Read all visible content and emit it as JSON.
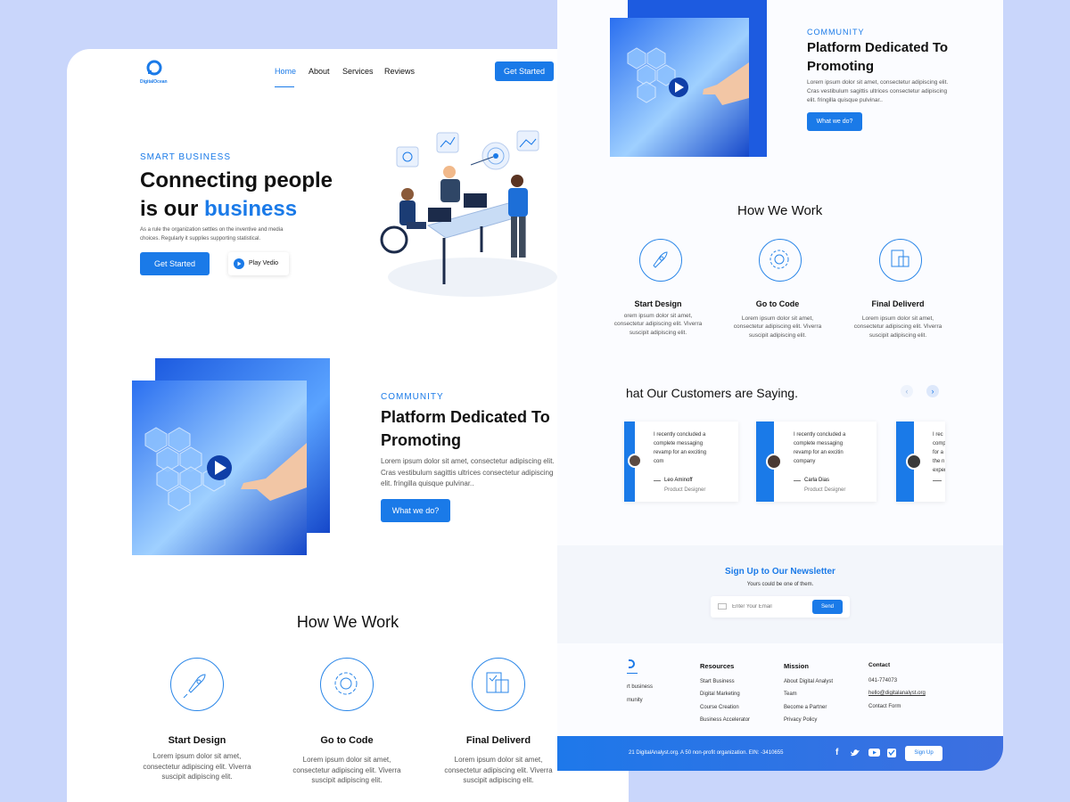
{
  "nav": {
    "logo_text": "DigitalOcean",
    "items": [
      "Home",
      "About",
      "Services",
      "Reviews"
    ],
    "cta": "Get Started"
  },
  "hero": {
    "eyebrow": "SMART BUSINESS",
    "title_line1": "Connecting people",
    "title_line2_prefix": "is our ",
    "title_line2_accent": "business",
    "desc_line1": "As a rule the organization settles on the inventive and media",
    "desc_line2": "choices. Regularly it supplies supporting statistical.",
    "primary_btn": "Get Started",
    "secondary_btn": "Play Vedio"
  },
  "community": {
    "eyebrow": "COMMUNITY",
    "title_line1": "Platform Dedicated To",
    "title_line2": "Promoting",
    "desc_line1": "Lorem ipsum dolor sit amet, consectetur adipiscing elit.",
    "desc_line2": "Cras vestibulum sagittis ultrices  consectetur adipiscing",
    "desc_line3": "elit. fringilla quisque pulvinar..",
    "btn": "What we do?"
  },
  "how": {
    "title": "How We Work",
    "steps": [
      {
        "title": "Start Design",
        "l1": "Lorem ipsum dolor sit amet,",
        "l2": "consectetur adipiscing elit. Viverra",
        "l3": "suscipit adipiscing elit.",
        "icon": "rocket-icon"
      },
      {
        "title": "Go to Code",
        "l1": "Lorem ipsum dolor sit amet,",
        "l2": "consectetur adipiscing elit. Viverra",
        "l3": "suscipit adipiscing elit.",
        "icon": "code-gear-icon"
      },
      {
        "title": "Final Deliverd",
        "l1": "Lorem ipsum dolor sit amet,",
        "l2": "consectetur adipiscing elit. Viverra",
        "l3": "suscipit adipiscing elit.",
        "icon": "clipboard-icon"
      }
    ]
  },
  "right": {
    "step1_l1": "orem ipsum dolor sit amet,",
    "step1_l2": "consectetur adipiscing elit. Viverra",
    "testimonials_title": "hat Our Customers are Saying.",
    "reviews": [
      {
        "q1": "I recently concluded a",
        "q2": "complete messaging",
        "q3": "revamp for an exciting",
        "q4": "com",
        "name": "Leo Aminoff",
        "role": "Product Designer"
      },
      {
        "q1": "I recently concluded a",
        "q2": "complete messaging",
        "q3": "revamp for an excitin",
        "q4": "company",
        "name": "Carla Dias",
        "role": "Product Designer"
      },
      {
        "q1": "I rec",
        "q2": "comp",
        "q3": "for a",
        "q4": "the n",
        "q5": "exper",
        "name": "",
        "role": ""
      }
    ],
    "newsletter": {
      "title": "Sign Up to Our Newsletter",
      "subtitle": "Yours could be one of them.",
      "placeholder": "Enter Your Email",
      "send": "Send"
    },
    "footer": {
      "brand_l1": "rt business",
      "brand_l2": "munity",
      "resources_title": "Resources",
      "resources": [
        "Start Business",
        "Digital Marketing",
        "Course Creation",
        "Business Accelerator"
      ],
      "mission_title": "Mission",
      "mission": [
        "About Digital Analyst",
        "Team",
        "Become a Partner",
        "Privacy Policy"
      ],
      "contact_title": "Contact",
      "contact": [
        "041-774073",
        "hello@digitalanalyst.org",
        "Contact Form"
      ],
      "copyright": "21 DigitalAnalyst.org. A 50 non-profit organization. EIN: -3410655",
      "signup": "Sign Up"
    }
  },
  "colors": {
    "accent": "#1a7ae8",
    "background": "#c9d6fb",
    "footer_bar": "#1e78ea"
  }
}
